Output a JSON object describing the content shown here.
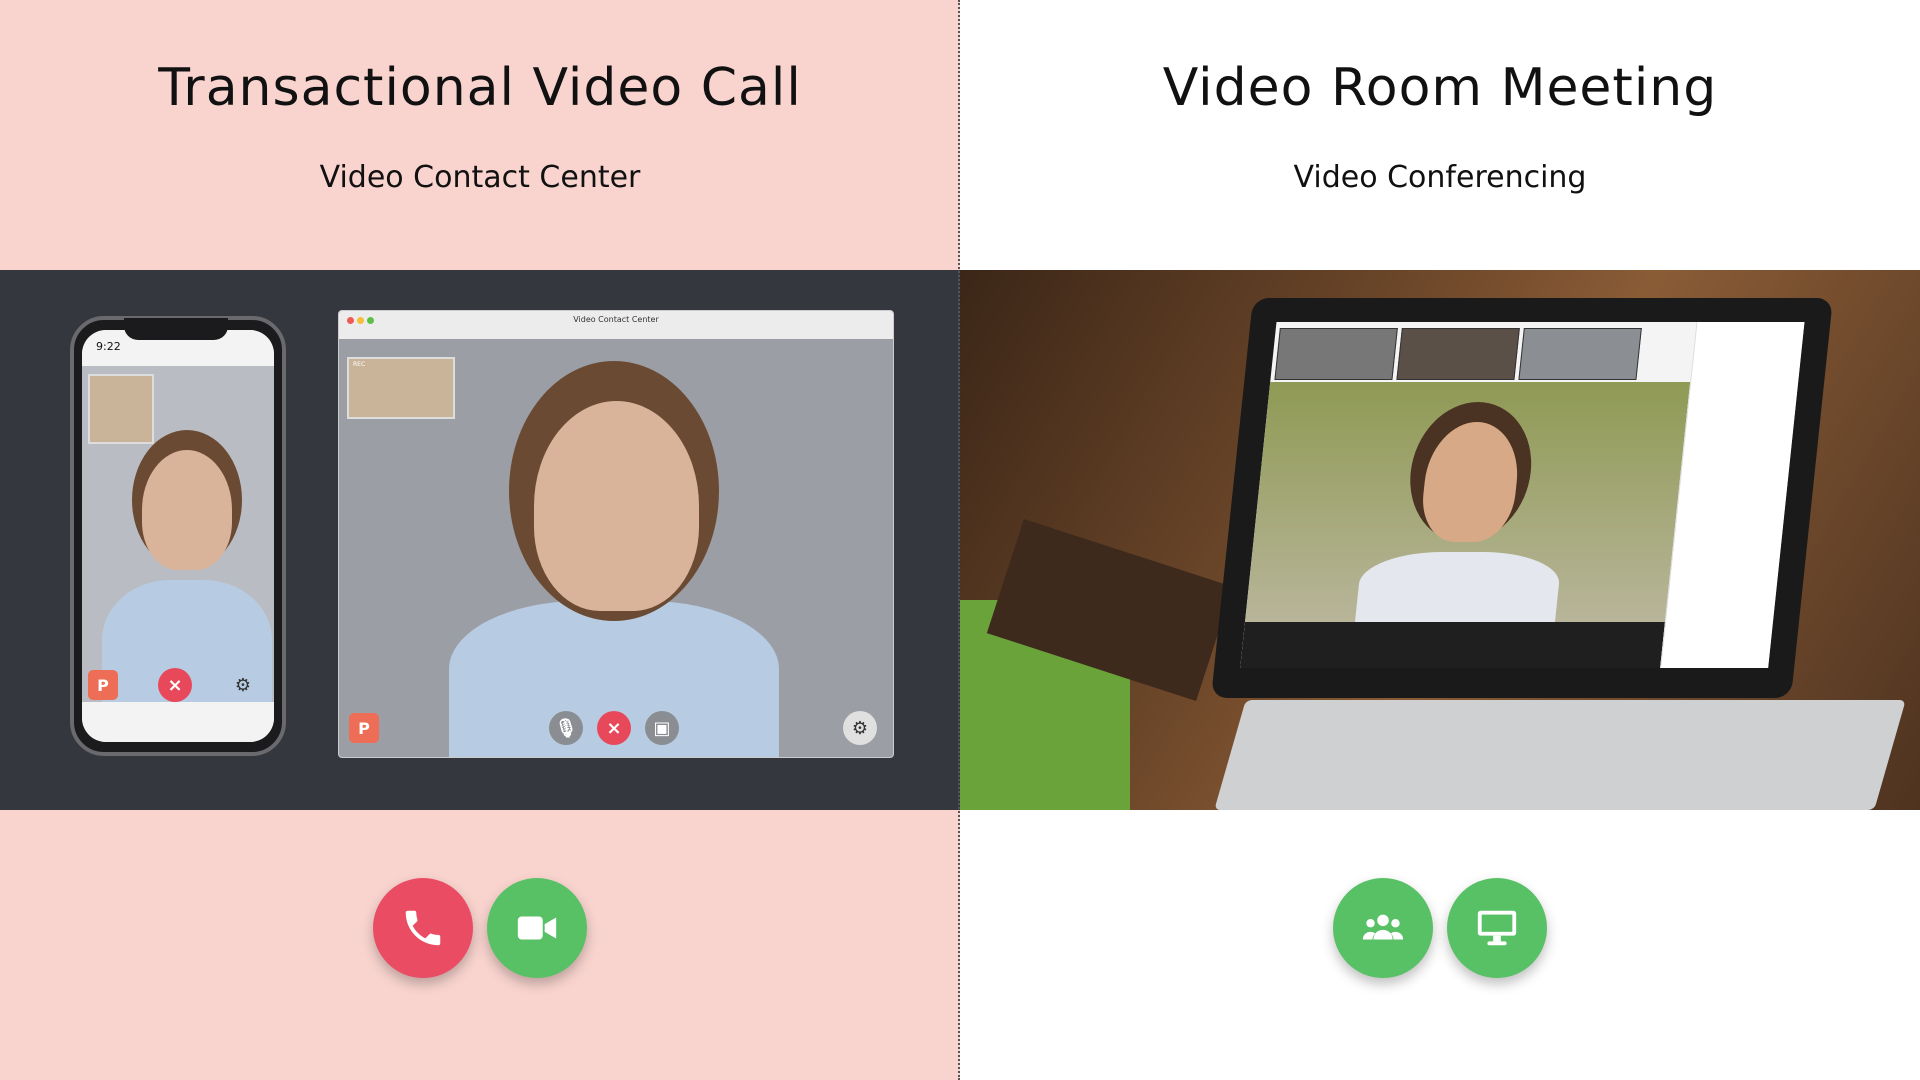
{
  "left": {
    "title": "Transactional Video Call",
    "subtitle": "Video Contact Center",
    "phone_time": "9:22",
    "desktop_window_title": "Video Contact Center",
    "rec_label": "REC",
    "actions": [
      {
        "name": "phone-icon",
        "color": "#ea4c63"
      },
      {
        "name": "video-camera-icon",
        "color": "#58c165"
      }
    ]
  },
  "right": {
    "title": "Video Room Meeting",
    "subtitle": "Video Conferencing",
    "actions": [
      {
        "name": "users-group-icon",
        "color": "#58c165"
      },
      {
        "name": "monitor-icon",
        "color": "#58c165"
      }
    ]
  }
}
